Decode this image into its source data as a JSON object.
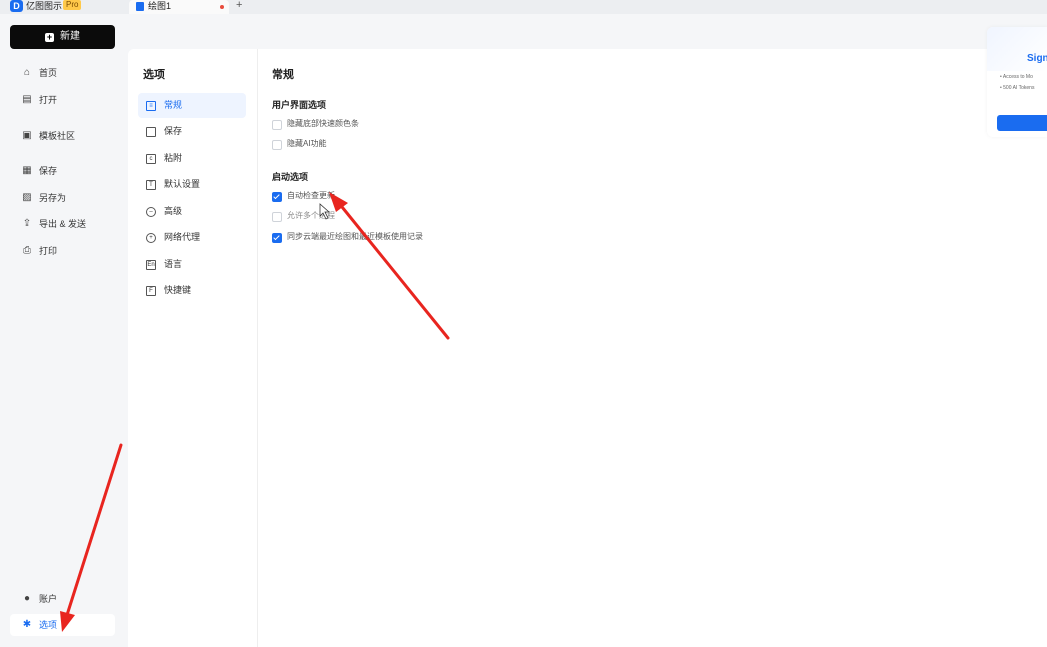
{
  "app": {
    "name": "亿图图示",
    "badge": "Pro"
  },
  "tabs": [
    {
      "label": "绘图1"
    }
  ],
  "left_nav": {
    "new_button": "新建",
    "items": [
      {
        "label": "首页",
        "icon": "home-icon"
      },
      {
        "label": "打开",
        "icon": "file-open-icon"
      },
      {
        "label": "模板社区",
        "icon": "template-icon"
      },
      {
        "label": "保存",
        "icon": "save-icon"
      },
      {
        "label": "另存为",
        "icon": "save-as-icon"
      },
      {
        "label": "导出 & 发送",
        "icon": "export-icon"
      },
      {
        "label": "打印",
        "icon": "print-icon"
      }
    ],
    "bottom_items": [
      {
        "label": "账户",
        "icon": "account-icon"
      },
      {
        "label": "选项",
        "icon": "gear-icon"
      }
    ]
  },
  "options": {
    "title": "选项",
    "menu": [
      {
        "label": "常规",
        "icon": "general-icon"
      },
      {
        "label": "保存",
        "icon": "save-icon"
      },
      {
        "label": "粘附",
        "icon": "snap-icon"
      },
      {
        "label": "默认设置",
        "icon": "default-settings-icon"
      },
      {
        "label": "高级",
        "icon": "advanced-icon"
      },
      {
        "label": "网络代理",
        "icon": "proxy-icon"
      },
      {
        "label": "语言",
        "icon": "language-icon"
      },
      {
        "label": "快捷键",
        "icon": "shortcut-icon"
      }
    ],
    "active_menu": "常规"
  },
  "general": {
    "title": "常规",
    "ui_section": {
      "title": "用户界面选项",
      "options": [
        {
          "label": "隐藏底部快速颜色条",
          "checked": false
        },
        {
          "label": "隐藏AI功能",
          "checked": false
        }
      ]
    },
    "startup_section": {
      "title": "启动选项",
      "options": [
        {
          "label": "自动检查更新",
          "checked": true
        },
        {
          "label": "允许多个进程",
          "checked": false
        },
        {
          "label": "同步云端最近绘图和最近模板使用记录",
          "checked": true
        }
      ]
    }
  },
  "promo": {
    "title": "Sign",
    "lines": [
      "• Access to Mo",
      "• 500 AI Tokens"
    ]
  },
  "colors": {
    "accent": "#1a6cf0",
    "arrow": "#e8251f"
  }
}
